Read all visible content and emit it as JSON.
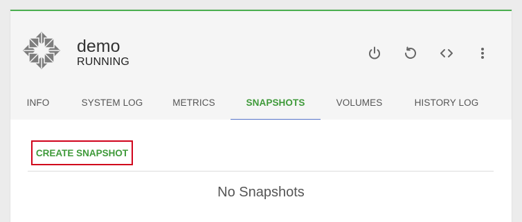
{
  "vm": {
    "name": "demo",
    "state": "RUNNING",
    "logo_icon": "centos-logo-icon"
  },
  "actions": [
    {
      "name": "power-icon",
      "label": "Power"
    },
    {
      "name": "restart-icon",
      "label": "Restart"
    },
    {
      "name": "console-icon",
      "label": "Console"
    },
    {
      "name": "more-vertical-icon",
      "label": "More"
    }
  ],
  "tabs": [
    {
      "label": "INFO",
      "active": false
    },
    {
      "label": "SYSTEM LOG",
      "active": false
    },
    {
      "label": "METRICS",
      "active": false
    },
    {
      "label": "SNAPSHOTS",
      "active": true
    },
    {
      "label": "VOLUMES",
      "active": false
    },
    {
      "label": "HISTORY LOG",
      "active": false
    }
  ],
  "snapshots": {
    "create_label": "CREATE SNAPSHOT",
    "empty_text": "No Snapshots"
  },
  "colors": {
    "accent_green": "#3f9a3a",
    "status_bar": "#4caf50",
    "tab_underline": "#5473c8",
    "highlight": "#d0021b"
  }
}
